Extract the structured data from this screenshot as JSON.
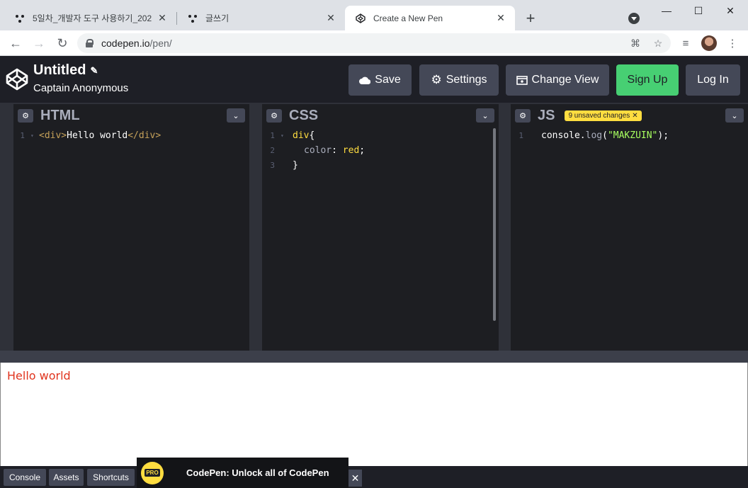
{
  "browser": {
    "tabs": [
      {
        "title": "5일차_개발자 도구 사용하기_202",
        "icon": "three-dot-favicon-icon"
      },
      {
        "title": "글쓰기",
        "icon": "three-dot-favicon-icon"
      },
      {
        "title": "Create a New Pen",
        "icon": "codepen-favicon-icon",
        "active": true
      }
    ],
    "new_tab": "+",
    "window_controls": {
      "minimize": "—",
      "maximize": "☐",
      "close": "✕"
    },
    "address": {
      "host": "codepen.io",
      "path": "/pen/"
    }
  },
  "header": {
    "title": "Untitled",
    "owner": "Captain Anonymous",
    "buttons": {
      "save": "Save",
      "settings": "Settings",
      "change_view": "Change View",
      "sign_up": "Sign Up",
      "log_in": "Log In"
    }
  },
  "editors": {
    "html": {
      "label": "HTML",
      "lines": [
        "1"
      ]
    },
    "css": {
      "label": "CSS",
      "lines": [
        "1",
        "2",
        "3"
      ]
    },
    "js": {
      "label": "JS",
      "lines": [
        "1"
      ],
      "badge": "9 unsaved changes"
    }
  },
  "code": {
    "html_line1": {
      "open": "<div>",
      "text": "Hello world",
      "close": "</div>"
    },
    "css_line1": {
      "sel": "div",
      "brace": "{"
    },
    "css_line2": {
      "prop": "color",
      "colon": ": ",
      "val": "red",
      "semi": ";"
    },
    "css_line3": {
      "brace": "}"
    },
    "js_line1": {
      "obj": "console.",
      "fn": "log",
      "open": "(",
      "str": "\"MAKZUIN\"",
      "close": ");"
    }
  },
  "preview": {
    "text": "Hello world"
  },
  "footer": {
    "console": "Console",
    "assets": "Assets",
    "shortcuts": "Shortcuts",
    "promo_badge": "PRO",
    "promo_text": "CodePen: Unlock all of CodePen",
    "promo_close": "✕"
  },
  "colors": {
    "accent_green": "#47cf73",
    "badge_yellow": "#ffdd40",
    "preview_red": "#e0341e",
    "header_bg": "#1e1f26"
  }
}
